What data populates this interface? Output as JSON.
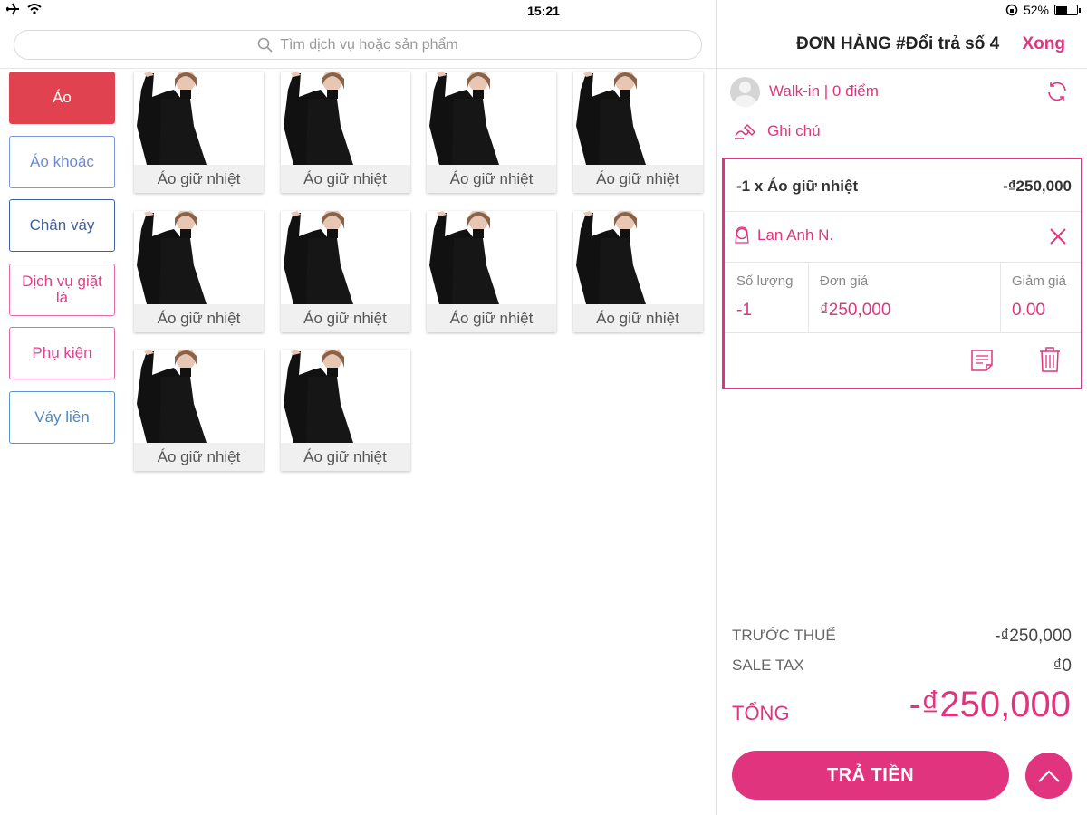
{
  "status_bar": {
    "time": "15:21",
    "battery_percent": "52%",
    "battery_level": 0.52
  },
  "search": {
    "placeholder": "Tìm dịch vụ hoặc sản phẩm"
  },
  "categories": [
    {
      "label": "Áo",
      "active": true
    },
    {
      "label": "Áo khoác",
      "active": false
    },
    {
      "label": "Chân váy",
      "active": false
    },
    {
      "label": "Dịch vụ giặt là",
      "active": false
    },
    {
      "label": "Phụ kiện",
      "active": false
    },
    {
      "label": "Váy liền",
      "active": false
    }
  ],
  "products": [
    {
      "name": "Áo giữ nhiệt"
    },
    {
      "name": "Áo giữ nhiệt"
    },
    {
      "name": "Áo giữ nhiệt"
    },
    {
      "name": "Áo giữ nhiệt"
    },
    {
      "name": "Áo giữ nhiệt"
    },
    {
      "name": "Áo giữ nhiệt"
    },
    {
      "name": "Áo giữ nhiệt"
    },
    {
      "name": "Áo giữ nhiệt"
    },
    {
      "name": "Áo giữ nhiệt"
    },
    {
      "name": "Áo giữ nhiệt"
    }
  ],
  "order": {
    "title": "ĐƠN HÀNG #Đổi trả số 4",
    "done_label": "Xong",
    "customer": "Walk-in | 0 điểm",
    "note_label": "Ghi chú",
    "item": {
      "title": "-1 x Áo giữ nhiệt",
      "price": "-₫250,000",
      "staff": "Lan Anh N.",
      "qty_label": "Số lượng",
      "qty_value": "-1",
      "unit_price_label": "Đơn giá",
      "unit_price_value": "₫250,000",
      "discount_label": "Giảm giá",
      "discount_value": "0.00"
    },
    "summary": {
      "subtotal_label": "TRƯỚC THUẾ",
      "subtotal_value": "-₫250,000",
      "tax_label": "SALE TAX",
      "tax_value": "₫0",
      "total_label": "TỔNG",
      "total_value": "-₫250,000"
    },
    "pay_label": "TRẢ TIỀN"
  },
  "colors": {
    "accent": "#e0357e",
    "active_category": "#e0434f"
  }
}
